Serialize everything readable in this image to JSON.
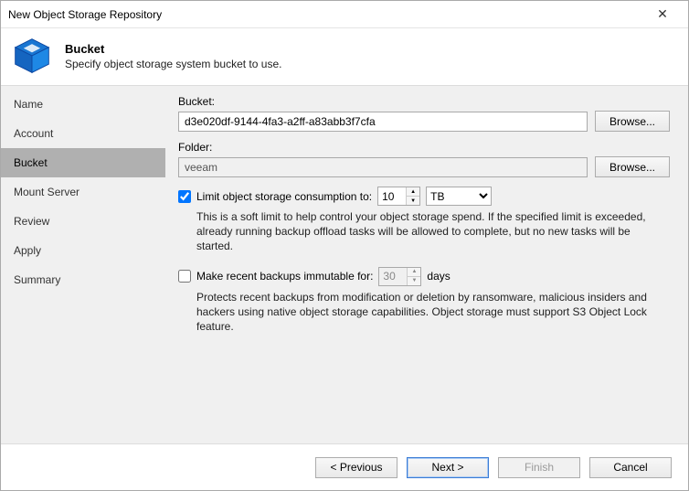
{
  "window": {
    "title": "New Object Storage Repository"
  },
  "header": {
    "title": "Bucket",
    "subtitle": "Specify object storage system bucket to use."
  },
  "sidebar": {
    "items": [
      {
        "label": "Name"
      },
      {
        "label": "Account"
      },
      {
        "label": "Bucket"
      },
      {
        "label": "Mount Server"
      },
      {
        "label": "Review"
      },
      {
        "label": "Apply"
      },
      {
        "label": "Summary"
      }
    ],
    "activeIndex": 2
  },
  "form": {
    "bucket_label": "Bucket:",
    "bucket_value": "d3e020df-9144-4fa3-a2ff-a83abb3f7cfa",
    "bucket_browse": "Browse...",
    "folder_label": "Folder:",
    "folder_value": "veeam",
    "folder_browse": "Browse...",
    "limit": {
      "checked": true,
      "label": "Limit object storage consumption to:",
      "value": "10",
      "unit": "TB",
      "desc": "This is a soft limit to help control your object storage spend. If the specified limit is exceeded, already running backup offload tasks will be allowed to complete, but no new tasks will be started."
    },
    "immutable": {
      "checked": false,
      "label": "Make recent backups immutable for:",
      "value": "30",
      "unit_label": "days",
      "desc": "Protects recent backups from modification or deletion by ransomware, malicious insiders and hackers using native object storage capabilities. Object storage must support S3 Object Lock feature."
    }
  },
  "footer": {
    "previous": "< Previous",
    "next": "Next >",
    "finish": "Finish",
    "cancel": "Cancel"
  }
}
